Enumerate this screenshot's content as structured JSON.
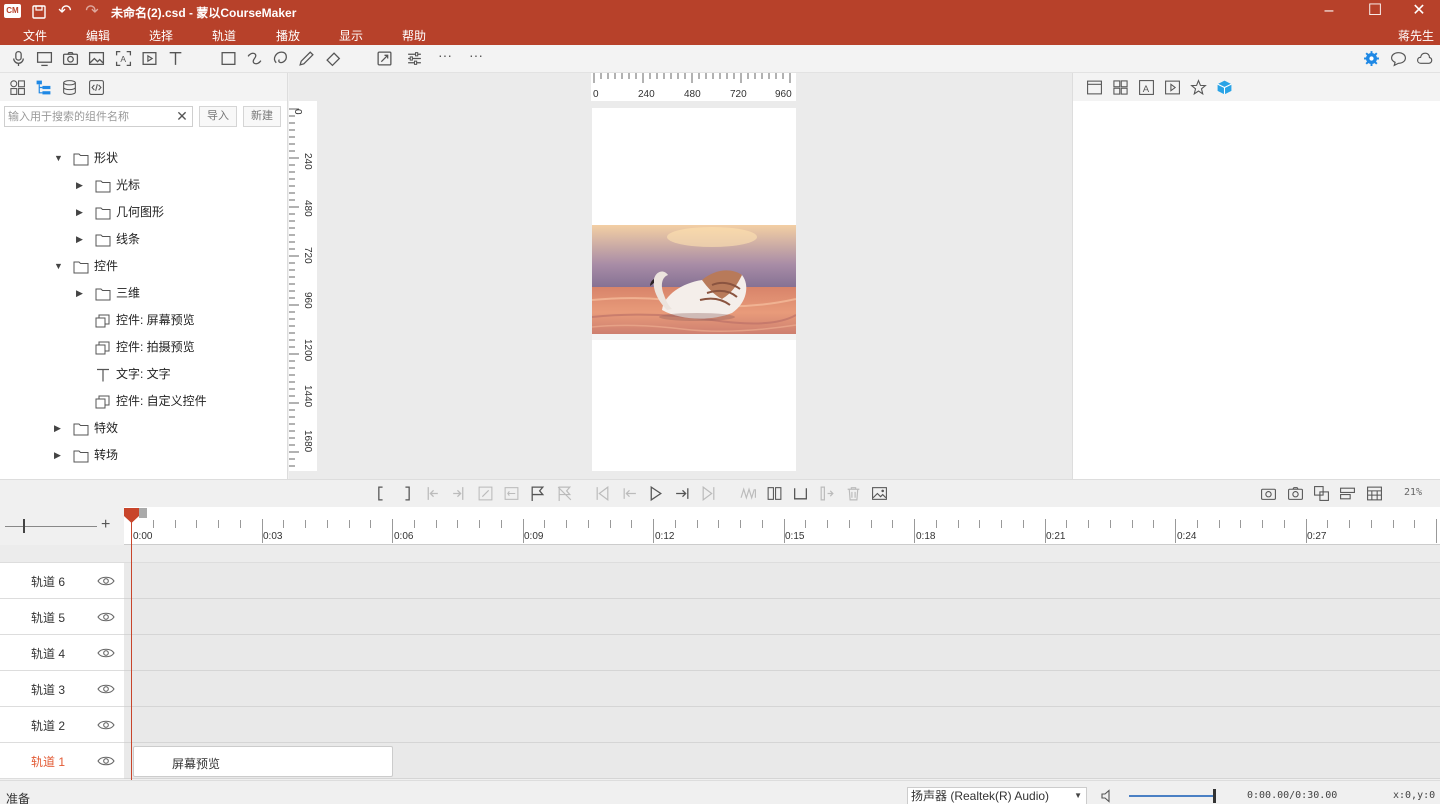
{
  "window": {
    "title": "未命名(2).csd - 蒙以CourseMaker",
    "logo_text": "CM",
    "user": "蒋先生",
    "accent_color": "#b7412a"
  },
  "menu": [
    "文件",
    "编辑",
    "选择",
    "轨道",
    "播放",
    "显示",
    "帮助"
  ],
  "toolbar_icons": [
    "microphone-icon",
    "screen-record-icon",
    "camera-icon",
    "image-icon",
    "ocr-icon",
    "video-icon",
    "text-icon",
    "rectangle-icon",
    "curve-icon",
    "lasso-icon",
    "pen-icon",
    "eraser-icon",
    "crop-icon",
    "settings-sliders-icon",
    "more-icon",
    "more-icon-2",
    "gear-icon",
    "comment-icon",
    "cloud-icon"
  ],
  "left_panel": {
    "search_placeholder": "输入用于搜索的组件名称",
    "import_label": "导入",
    "new_label": "新建",
    "tree": [
      {
        "label": "形状",
        "type": "folder",
        "expanded": true,
        "level": 1
      },
      {
        "label": "光标",
        "type": "folder",
        "expanded": false,
        "level": 2
      },
      {
        "label": "几何图形",
        "type": "folder",
        "expanded": false,
        "level": 2
      },
      {
        "label": "线条",
        "type": "folder",
        "expanded": false,
        "level": 2
      },
      {
        "label": "控件",
        "type": "folder",
        "expanded": true,
        "level": 1
      },
      {
        "label": "三维",
        "type": "folder",
        "expanded": false,
        "level": 2
      },
      {
        "label": "控件: 屏幕预览",
        "type": "widget",
        "level": 2
      },
      {
        "label": "控件: 拍摄预览",
        "type": "widget",
        "level": 2
      },
      {
        "label": "文字: 文字",
        "type": "text",
        "level": 2
      },
      {
        "label": "控件: 自定义控件",
        "type": "widget",
        "level": 2
      },
      {
        "label": "特效",
        "type": "folder",
        "expanded": false,
        "level": 1
      },
      {
        "label": "转场",
        "type": "folder",
        "expanded": false,
        "level": 1
      }
    ]
  },
  "canvas": {
    "h_ruler": [
      "0",
      "240",
      "480",
      "720",
      "960"
    ],
    "v_ruler": [
      "0",
      "240",
      "480",
      "720",
      "960",
      "1200",
      "1440",
      "1680"
    ]
  },
  "timeline": {
    "zoom": "21%",
    "time_labels": [
      "0:00",
      "0:03",
      "0:06",
      "0:09",
      "0:12",
      "0:15",
      "0:18",
      "0:21",
      "0:24",
      "0:27"
    ],
    "tracks": [
      {
        "name": "轨道 6",
        "active": false
      },
      {
        "name": "轨道 5",
        "active": false
      },
      {
        "name": "轨道 4",
        "active": false
      },
      {
        "name": "轨道 3",
        "active": false
      },
      {
        "name": "轨道 2",
        "active": false
      },
      {
        "name": "轨道 1",
        "active": true
      }
    ],
    "clip_label": "屏幕预览"
  },
  "status": {
    "text": "准备",
    "audio_device": "扬声器 (Realtek(R) Audio)",
    "volume": 1.0,
    "time": "0:00.00/0:30.00",
    "coords": "x:0,y:0"
  }
}
